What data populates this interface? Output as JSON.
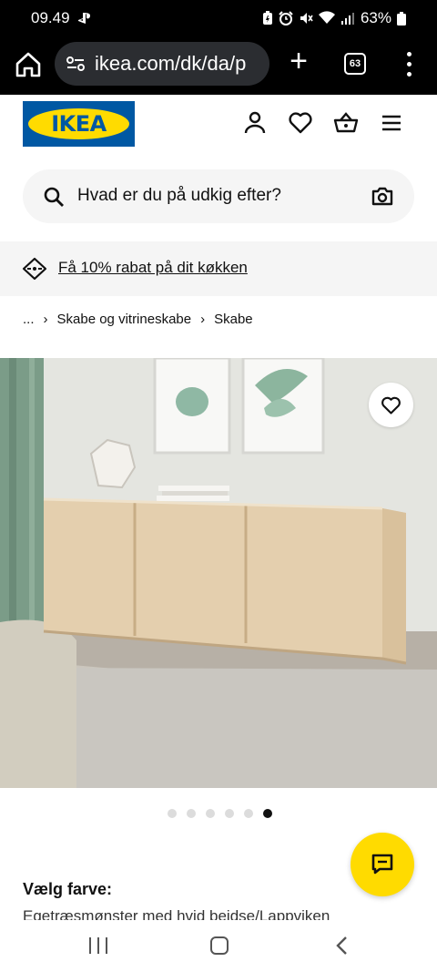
{
  "status": {
    "time": "09.49",
    "battery": "63%"
  },
  "browser": {
    "url": "ikea.com/dk/da/p",
    "tab_count": "63",
    "plus": "+"
  },
  "brand": {
    "logo_text": "IKEA",
    "blue": "#0058a3",
    "yellow": "#ffdb00"
  },
  "search": {
    "placeholder": "Hvad er du på udkig efter?"
  },
  "promo": {
    "link_text": "Få 10% rabat på dit køkken"
  },
  "breadcrumb": {
    "ellipsis": "...",
    "items": [
      "Skabe og vitrineskabe",
      "Skabe"
    ]
  },
  "gallery": {
    "total_images": 6,
    "active_index": 5
  },
  "product": {
    "color_label": "Vælg farve:",
    "color_value": "Egetræsmønster med hvid bejdse/Lappviken"
  },
  "icons": {
    "header": [
      "person-icon",
      "heart-icon",
      "basket-icon",
      "hamburger-icon"
    ],
    "search": [
      "search-icon",
      "camera-icon"
    ],
    "promo": "price-tag-icon",
    "chat": "chat-icon"
  }
}
